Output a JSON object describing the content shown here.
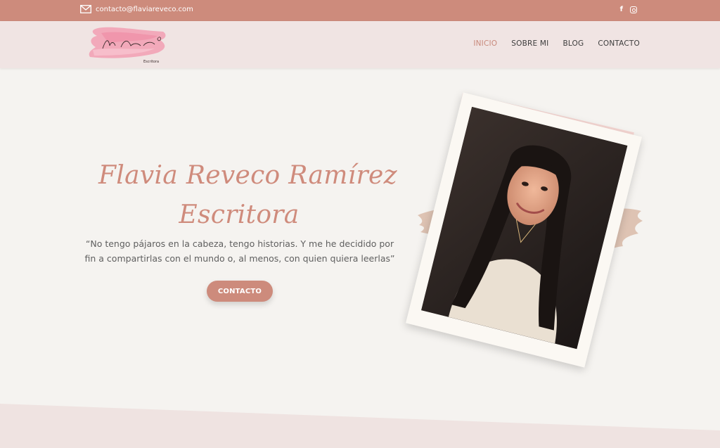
{
  "topbar": {
    "email": "contacto@flaviareveco.com",
    "icons": [
      "mail-icon",
      "facebook-icon",
      "instagram-icon"
    ],
    "facebook_glyph": "f"
  },
  "header": {
    "logo_text": "Flavia Reveco",
    "logo_subtext": "Escritora",
    "nav": [
      {
        "label": "INICIO",
        "active": true
      },
      {
        "label": "SOBRE MI",
        "active": false
      },
      {
        "label": "BLOG",
        "active": false
      },
      {
        "label": "CONTACTO",
        "active": false
      }
    ]
  },
  "hero": {
    "title_line1": "Flavia Reveco Ramírez",
    "title_line2": "Escritora",
    "quote": "“No tengo pájaros en la cabeza, tengo historias. Y me he decidido por fin a compartirlas con el mundo o, al menos, con quien quiera leerlas”",
    "cta_label": "CONTACTO"
  },
  "colors": {
    "accent": "#cd8b7c",
    "header_bg": "#f0e4e3",
    "page_bg": "#f5f3f0",
    "pink_paper": "#f5d6d2",
    "brush": "#dec3b3"
  }
}
